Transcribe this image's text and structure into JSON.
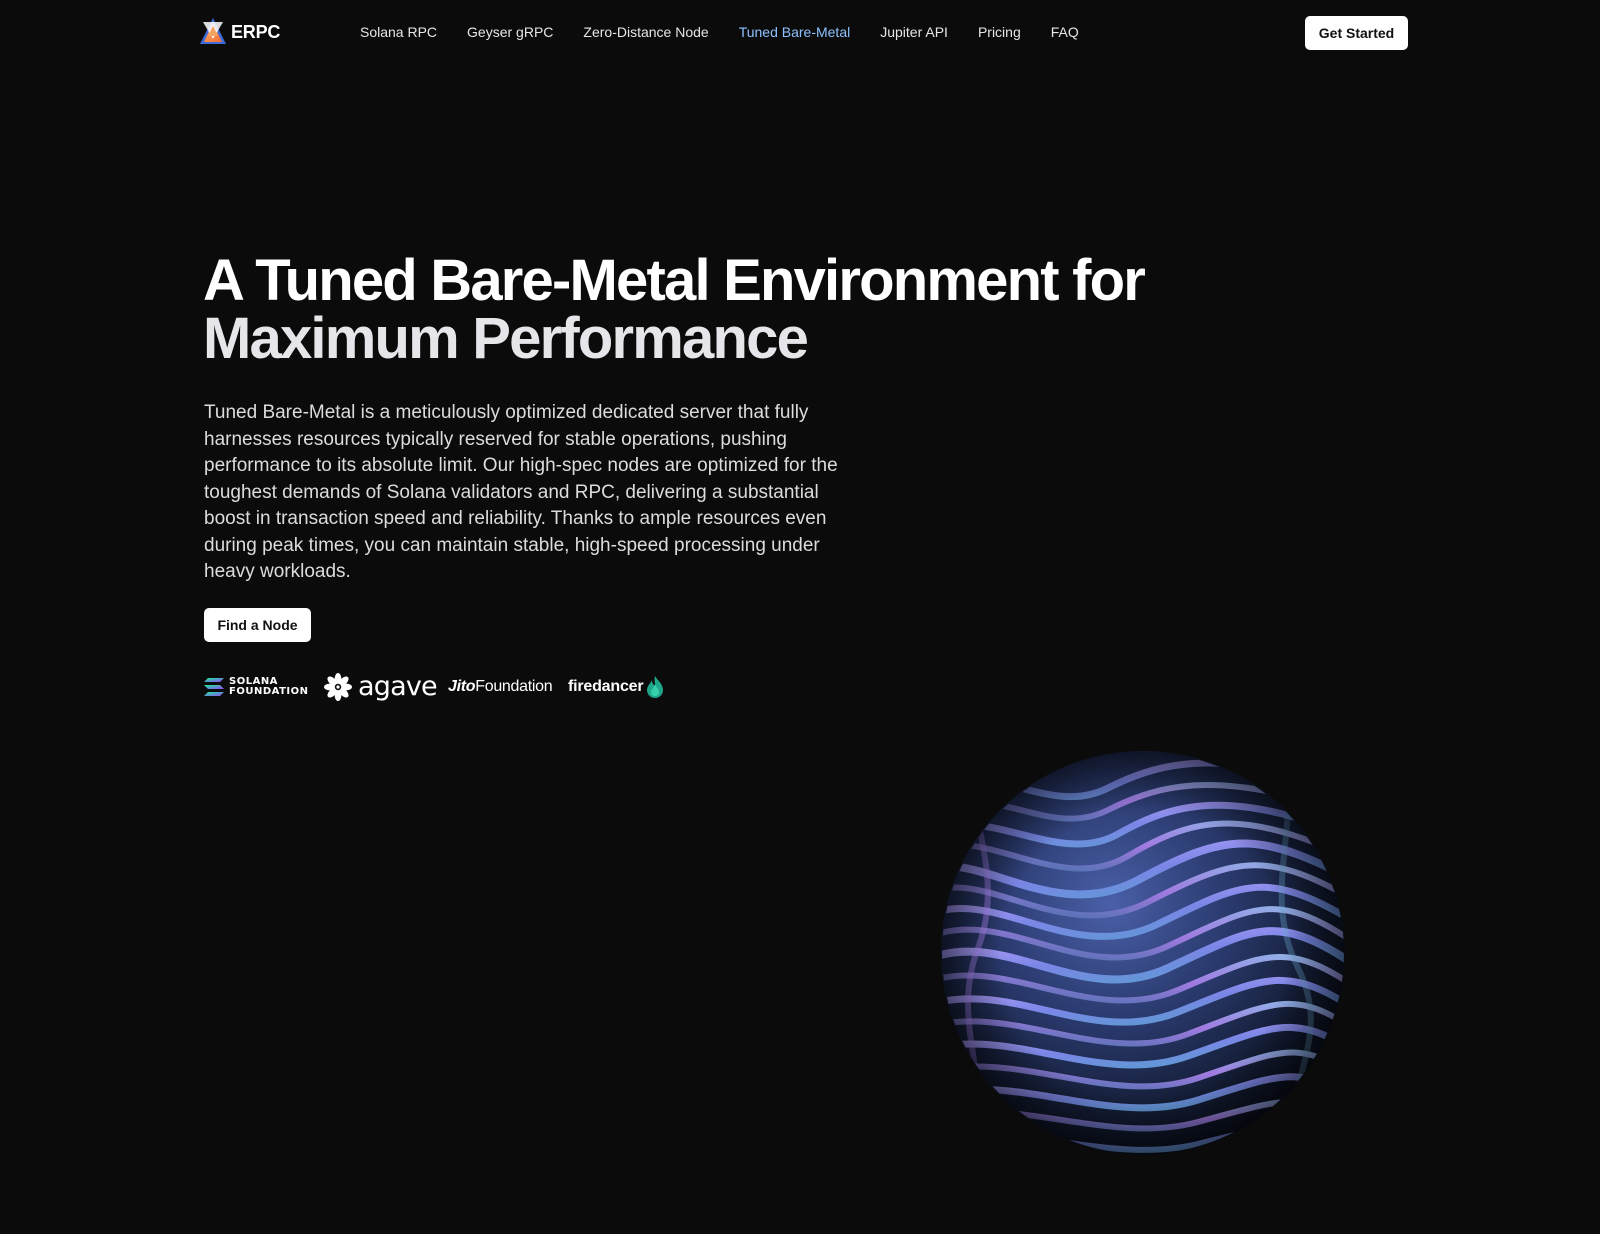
{
  "brand": {
    "name": "ERPC"
  },
  "nav": {
    "links": [
      {
        "label": "Solana RPC",
        "active": false
      },
      {
        "label": "Geyser gRPC",
        "active": false
      },
      {
        "label": "Zero-Distance Node",
        "active": false
      },
      {
        "label": "Tuned Bare-Metal",
        "active": true
      },
      {
        "label": "Jupiter API",
        "active": false
      },
      {
        "label": "Pricing",
        "active": false
      },
      {
        "label": "FAQ",
        "active": false
      }
    ],
    "cta_label": "Get Started"
  },
  "hero": {
    "title_line1": "A Tuned Bare-Metal Environment for",
    "title_line2": "Maximum Performance",
    "description": "Tuned Bare-Metal is a meticulously optimized dedicated server that fully harnesses resources typically reserved for stable operations, pushing performance to its absolute limit. Our high-spec nodes are optimized for the toughest demands of Solana validators and RPC, delivering a substantial boost in transaction speed and reliability. Thanks to ample resources even during peak times, you can maintain stable, high-speed processing under heavy workloads.",
    "cta_label": "Find a Node"
  },
  "partners": {
    "solana_line1": "SOLANA",
    "solana_line2": "FOUNDATION",
    "agave": "agave",
    "jito_bold": "Jito",
    "jito_rest": "Foundation",
    "firedancer": "firedancer"
  },
  "colors": {
    "background": "#0b0b0b",
    "active_link": "#8ec2ff",
    "button_bg": "#ffffff"
  },
  "icons": {
    "brand_logo": "erpc-logo-icon",
    "sphere": "wavy-sphere-graphic"
  }
}
